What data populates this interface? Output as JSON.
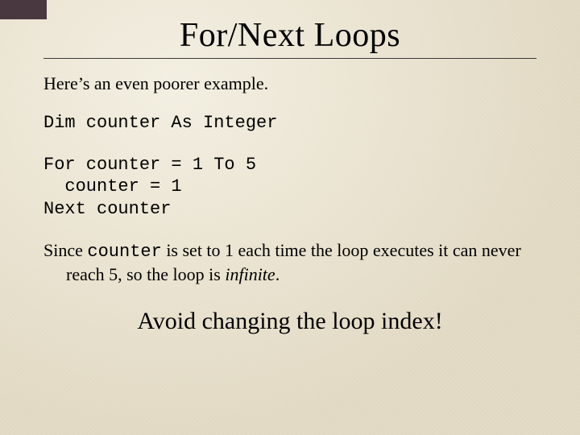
{
  "title": "For/Next Loops",
  "intro": "Here’s an even poorer example.",
  "code_line1": "Dim counter As Integer",
  "code_line2": "For counter = 1 To 5",
  "code_line3": "  counter = 1",
  "code_line4": "Next counter",
  "explain_pre": "Since ",
  "explain_code": "counter",
  "explain_mid": " is set to 1 each time the loop executes it can never reach 5, so the loop is ",
  "explain_em": "infinite",
  "explain_post": ".",
  "callout": "Avoid changing the loop index!"
}
